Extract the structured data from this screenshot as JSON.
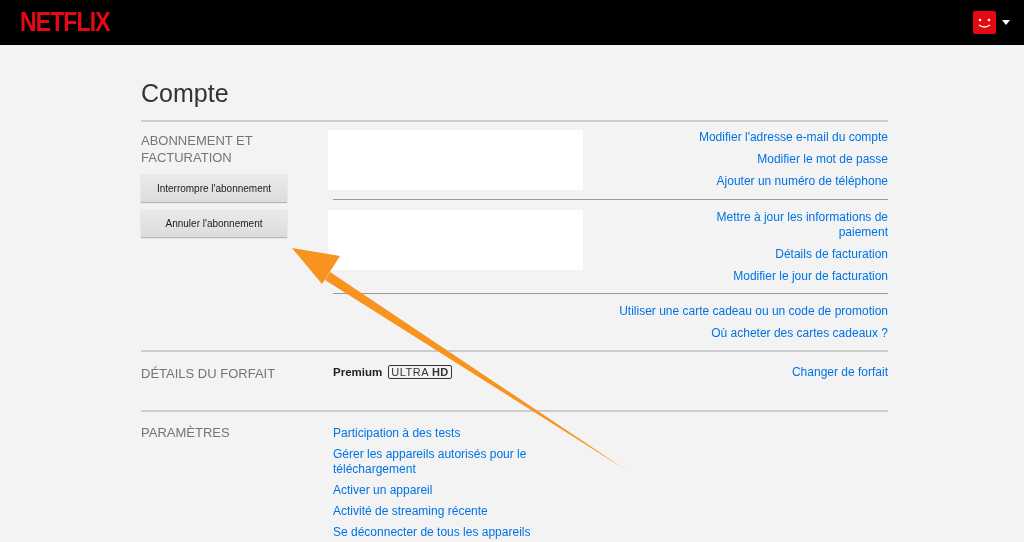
{
  "header": {
    "logo": "NETFLIX"
  },
  "page_title": "Compte",
  "membership": {
    "heading": "ABONNEMENT ET FACTURATION",
    "buttons": [
      "Interrompre l'abonnement",
      "Annuler l'abonnement"
    ],
    "groups": [
      {
        "redacted": true,
        "links": [
          "Modifier l'adresse e-mail du compte",
          "Modifier le mot de passe",
          "Ajouter un numéro de téléphone"
        ]
      },
      {
        "redacted": true,
        "links": [
          "Mettre à jour les informations de paiement",
          "Détails de facturation",
          "Modifier le jour de facturation"
        ]
      },
      {
        "redacted": false,
        "links": [
          "Utiliser une carte cadeau ou un code de promotion",
          "Où acheter des cartes cadeaux ?"
        ]
      }
    ]
  },
  "plan": {
    "heading": "DÉTAILS DU FORFAIT",
    "name": "Premium",
    "badge": "ULTRA **HD**",
    "links": [
      "Changer de forfait"
    ]
  },
  "settings": {
    "heading": "PARAMÈTRES",
    "links": [
      "Participation à des tests",
      "Gérer les appareils autorisés pour le téléchargement",
      "Activer un appareil",
      "Activité de streaming récente",
      "Se déconnecter de tous les appareils"
    ]
  }
}
